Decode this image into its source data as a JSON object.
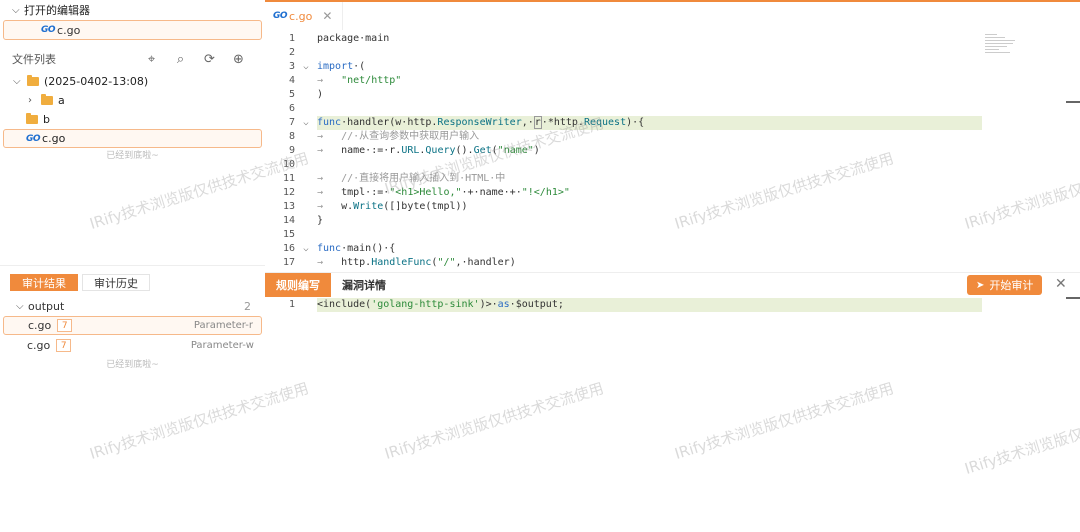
{
  "open_editors": {
    "title": "打开的编辑器",
    "file": "c.go",
    "go_logo": "GO"
  },
  "file_list": {
    "title": "文件列表",
    "tools": [
      "locate-icon",
      "search-icon",
      "refresh-icon",
      "add-icon"
    ],
    "root": "(2025-0402-13:08)",
    "items": [
      {
        "name": "a",
        "type": "folder"
      },
      {
        "name": "b",
        "type": "folder"
      },
      {
        "name": "c.go",
        "type": "go-file"
      }
    ],
    "end_text": "已经到底啦~"
  },
  "audit": {
    "tabs": [
      "审计结果",
      "审计历史"
    ],
    "group": "output",
    "count": "2",
    "results": [
      {
        "file": "c.go",
        "badge": "7",
        "type": "Parameter-r"
      },
      {
        "file": "c.go",
        "badge": "7",
        "type": "Parameter-w"
      }
    ],
    "end_text": "已经到底啦~"
  },
  "editor": {
    "tab_label": "c.go",
    "lines": [
      "1",
      "2",
      "3",
      "4",
      "5",
      "6",
      "7",
      "8",
      "9",
      "10",
      "11",
      "12",
      "13",
      "14",
      "15",
      "16",
      "17"
    ]
  },
  "bottom": {
    "tabs": [
      "规则编写",
      "漏洞详情"
    ],
    "start_button": "开始审计",
    "rule_line_no": "1"
  },
  "watermark": "IRify技术浏览版仅供技术交流使用",
  "colors": {
    "accent": "#f08a3c",
    "highlight": "#e9f0d8",
    "keyword": "#2b6cc4",
    "string": "#2d8a3a"
  }
}
